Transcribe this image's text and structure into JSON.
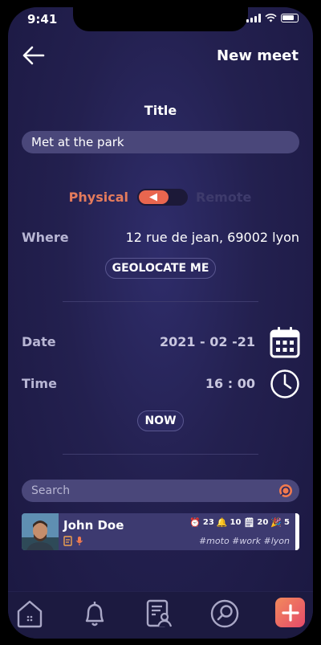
{
  "status_bar": {
    "time": "9:41"
  },
  "header": {
    "title": "New meet"
  },
  "form": {
    "title_label": "Title",
    "title_value": "Met at the park",
    "mode": {
      "left_label": "Physical",
      "right_label": "Remote",
      "selected": "Physical"
    },
    "where_label": "Where",
    "where_value": "12 rue de jean, 69002 lyon",
    "geolocate_label": "GEOLOCATE ME",
    "date_label": "Date",
    "date_value": "2021 - 02 -21",
    "time_label": "Time",
    "time_value": "16 : 00",
    "now_label": "NOW"
  },
  "search": {
    "placeholder": "Search"
  },
  "contacts": [
    {
      "name": "John Doe",
      "stats": {
        "alarms": "23",
        "notifications": "10",
        "notes": "20",
        "parties": "5"
      },
      "tags": "#moto #work #lyon"
    }
  ],
  "colors": {
    "accent": "#e9664f",
    "background": "#23204f",
    "field": "#4a477a"
  },
  "tabbar": {
    "icons": [
      "home-icon",
      "bell-icon",
      "contacts-list-icon",
      "search-icon",
      "add-icon"
    ]
  }
}
